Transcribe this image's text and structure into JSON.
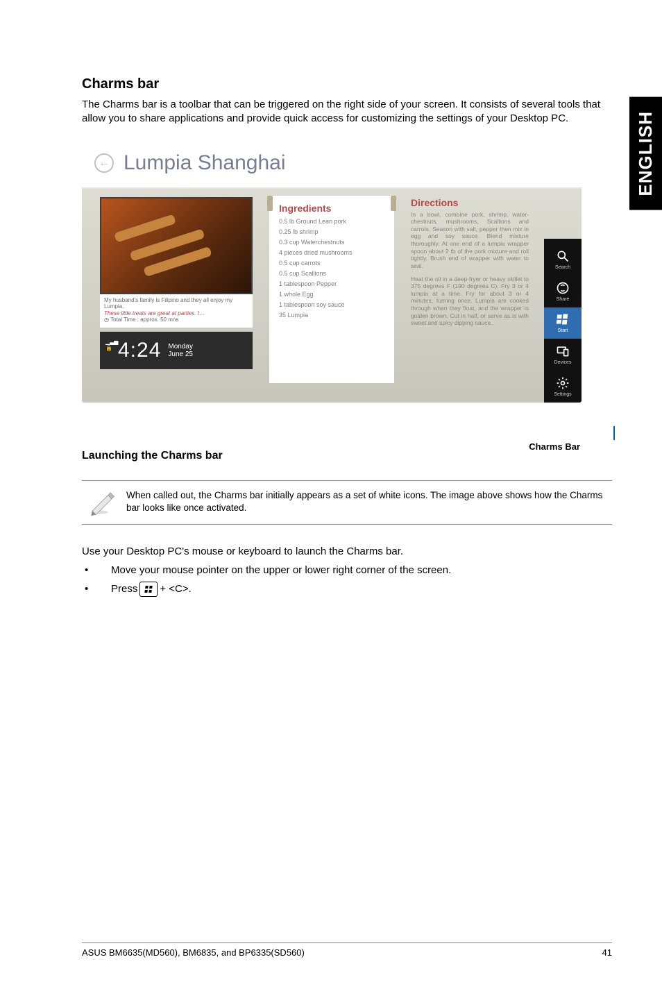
{
  "sideTab": "ENGLISH",
  "section": {
    "title": "Charms bar",
    "intro": "The Charms bar is a toolbar that can be triggered on the right side of your screen. It consists of several tools that allow you to share applications and provide quick access for customizing the settings of your Desktop PC."
  },
  "screenshot": {
    "backIcon": "←",
    "appTitle": "Lumpia Shanghai",
    "photoCaption": {
      "line1": "My husband's family is Filipino and they all enjoy my Lumpia.",
      "line2": "These little treats are great at parties. I…",
      "time": "Total Time : approx. 50 mns"
    },
    "clock": {
      "time": "4:24",
      "day": "Monday",
      "date": "June 25"
    },
    "ingredients": {
      "title": "Ingredients",
      "items": [
        "0.5 lb Ground Lean pork",
        "0.25 lb shrimp",
        "0.3 cup Waterchestnuts",
        "4 pieces dried mushrooms",
        "0.5 cup carrots",
        "0.5 cup Scallions",
        "1 tablespoon Pepper",
        "1 whole Egg",
        "1 tablespoon soy sauce",
        "35 Lumpia"
      ]
    },
    "directions": {
      "title": "Directions",
      "p1": "In a bowl, combine pork, shrimp, water-chestnuts, mushrooms, Scallions and carrots. Season with salt, pepper then mix in egg and soy sauce. Blend mixture thoroughly. At one end of a lumpia wrapper spoon about 2 tb of the pork mixture and roll tightly. Brush end of wrapper with water to seal.",
      "p2": "Heat the oil in a deep-fryer or heavy skillet to 375 degrees F (190 degrees C). Fry 3 or 4 lumpia at a time. Fry for about 3 or 4 minutes, turning once. Lumpia are cooked through when they float, and the wrapper is golden brown. Cut in half, or serve as is with sweet and spicy dipping sauce."
    },
    "charms": [
      {
        "name": "search",
        "label": "Search"
      },
      {
        "name": "share",
        "label": "Share"
      },
      {
        "name": "start",
        "label": "Start"
      },
      {
        "name": "devices",
        "label": "Devices"
      },
      {
        "name": "settings",
        "label": "Settings"
      }
    ]
  },
  "callout": "Charms Bar",
  "subsection": {
    "title": "Launching the Charms bar",
    "note": "When called out, the Charms bar initially appears as a set of white icons. The image above shows how the Charms bar looks like once activated.",
    "lead": "Use your Desktop PC's mouse or keyboard to launch the Charms bar.",
    "bullet1": "Move your mouse pointer on the upper or lower right corner of the screen.",
    "bullet2a": "Press",
    "bullet2b": "+ <C>."
  },
  "footer": {
    "left": "ASUS BM6635(MD560), BM6835, and BP6335(SD560)",
    "right": "41"
  }
}
